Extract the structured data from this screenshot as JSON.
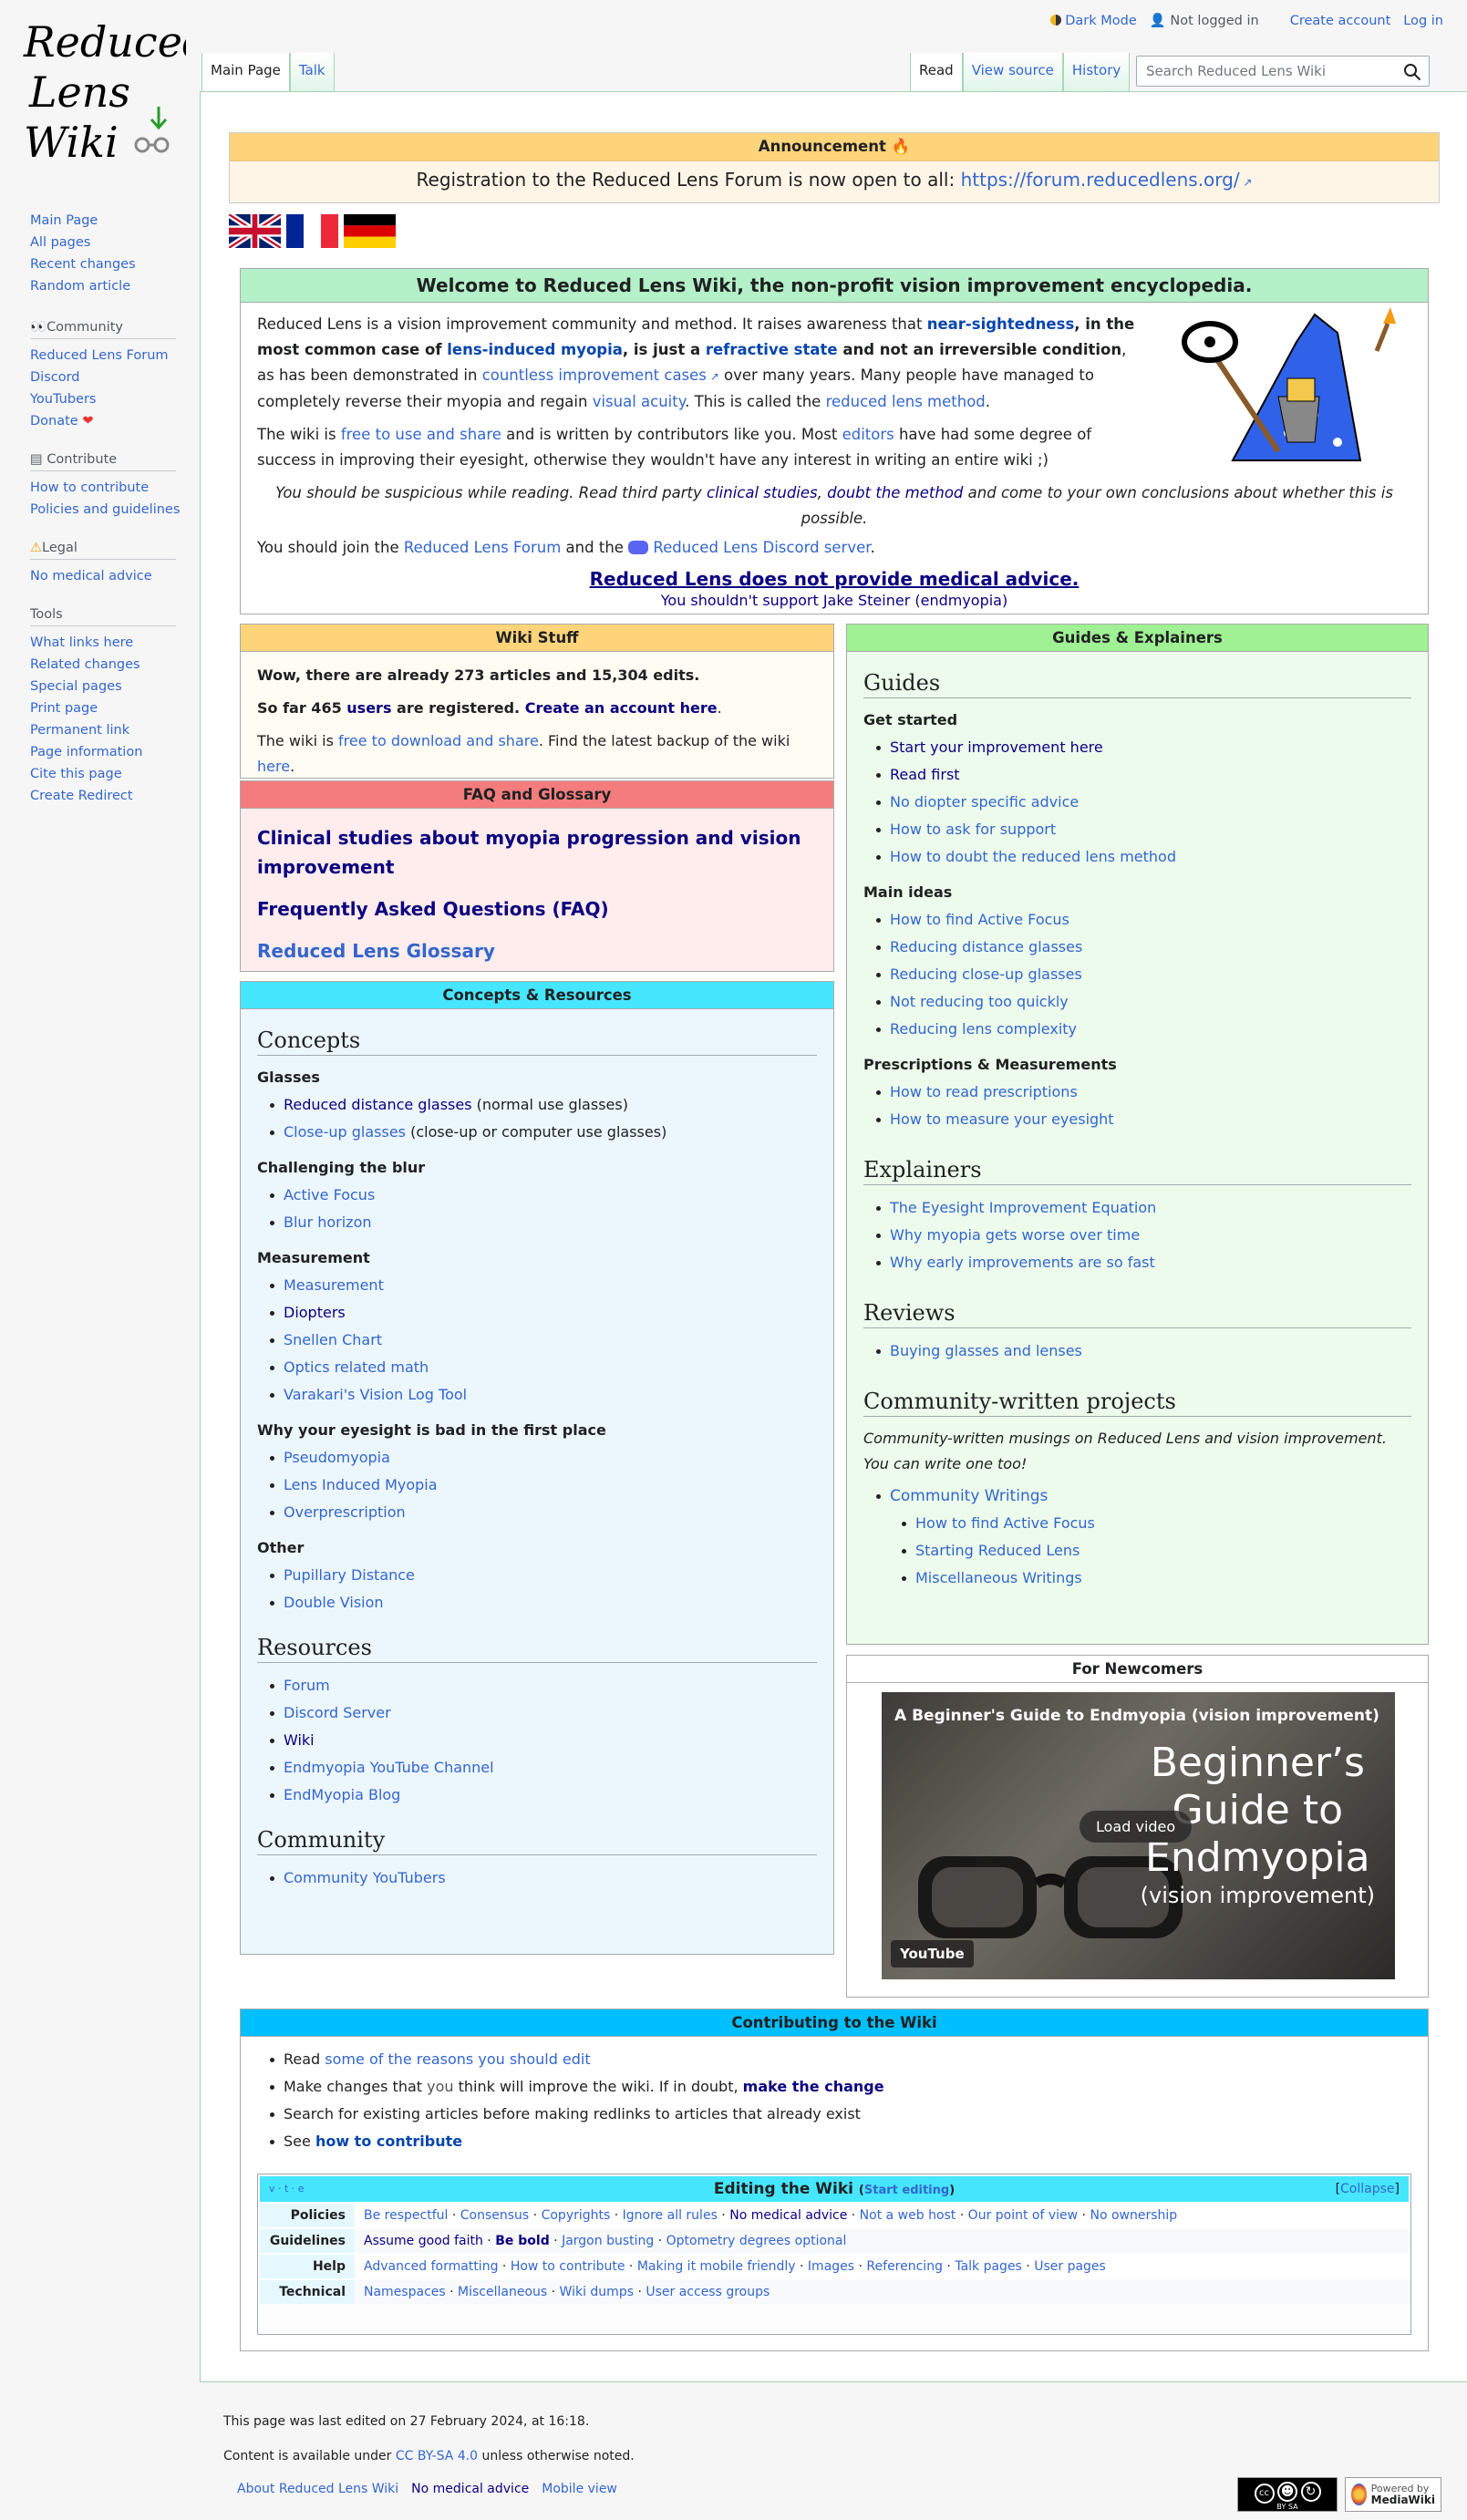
{
  "logo": {
    "line1": "Reduced",
    "line2": "Lens",
    "line3": "Wiki"
  },
  "personal": {
    "dark_mode": "Dark Mode",
    "not_logged_in": "Not logged in",
    "create_account": "Create account",
    "login": "Log in"
  },
  "tabs": {
    "main_page": "Main Page",
    "talk": "Talk",
    "read": "Read",
    "view_source": "View source",
    "history": "History"
  },
  "search": {
    "placeholder": "Search Reduced Lens Wiki"
  },
  "sidebar": {
    "nav": [
      "Main Page",
      "All pages",
      "Recent changes",
      "Random article"
    ],
    "community_heading": "Community",
    "community": [
      "Reduced Lens Forum",
      "Discord",
      "YouTubers",
      "Donate"
    ],
    "contribute_heading": "Contribute",
    "contribute": [
      "How to contribute",
      "Policies and guidelines"
    ],
    "legal_heading": "Legal",
    "legal": [
      "No medical advice"
    ],
    "tools_heading": "Tools",
    "tools": [
      "What links here",
      "Related changes",
      "Special pages",
      "Print page",
      "Permanent link",
      "Page information",
      "Cite this page",
      "Create Redirect"
    ]
  },
  "announcement": {
    "title": "Announcement",
    "text": "Registration to the Reduced Lens Forum is now open to all:",
    "link": "https://forum.reducedlens.org/"
  },
  "welcome": {
    "title": "Welcome to Reduced Lens Wiki, the non-profit vision improvement encyclopedia.",
    "p1a": "Reduced Lens is a vision improvement community and method. It raises awareness that ",
    "p1_near": "near-sightedness",
    "p1b": ", in the most common case of ",
    "p1_lim": "lens-induced myopia",
    "p1c": ", is just a ",
    "p1_rs": "refractive state",
    "p1d": " and not an irreversible condition",
    "p1e": ", as has been demonstrated in ",
    "p1_cic": "countless improvement cases",
    "p1f": " over many years. Many people have managed to completely reverse their myopia and regain ",
    "p1_va": "visual acuity",
    "p1g": ". This is called the ",
    "p1_rlm": "reduced lens method",
    "p1h": ".",
    "p2a": "The wiki is ",
    "p2_free": "free to use and share",
    "p2b": " and is written by contributors like you. Most ",
    "p2_ed": "editors",
    "p2c": " have had some degree of success in improving their eyesight, otherwise they wouldn't have any interest in writing an entire wiki ;)",
    "p3a": "You should be suspicious while reading. Read third party ",
    "p3_cs": "clinical studies",
    "p3b": ", ",
    "p3_dm": "doubt the method",
    "p3c": " and come to your own conclusions about whether this is possible.",
    "p4a": "You should join the ",
    "p4_forum": "Reduced Lens Forum",
    "p4b": " and the ",
    "p4_discord": "Reduced Lens Discord server",
    "p4c": ".",
    "medical": "Reduced Lens does not provide medical advice.",
    "support": "You shouldn't support Jake Steiner (endmyopia)"
  },
  "wiki_stuff": {
    "title": "Wiki Stuff",
    "line1": "Wow, there are already 273 articles and 15,304 edits.",
    "l2a": "So far 465 ",
    "l2_users": "users",
    "l2b": " are registered. ",
    "l2_create": "Create an account here",
    "l3a": "The wiki is ",
    "l3_free": "free to download and share",
    "l3b": ". Find the latest backup of the wiki ",
    "l3_here": "here",
    "l3c": "."
  },
  "faq": {
    "title": "FAQ and Glossary",
    "items": [
      "Clinical studies about myopia progression and vision improvement",
      "Frequently Asked Questions (FAQ)",
      "Reduced Lens Glossary"
    ]
  },
  "concepts": {
    "title": "Concepts & Resources",
    "h_concepts": "Concepts",
    "glasses": "Glasses",
    "g1": "Reduced distance glasses",
    "g1n": " (normal use glasses)",
    "g2": "Close-up glasses",
    "g2n": " (close-up or computer use glasses)",
    "blur": "Challenging the blur",
    "blur_items": [
      "Active Focus",
      "Blur horizon"
    ],
    "measurement": "Measurement",
    "meas_items": [
      "Measurement",
      "Diopters",
      "Snellen Chart",
      "Optics related math",
      "Varakari's Vision Log Tool"
    ],
    "bad": "Why your eyesight is bad in the first place",
    "bad_items": [
      "Pseudomyopia",
      "Lens Induced Myopia",
      "Overprescription"
    ],
    "other": "Other",
    "other_items": [
      "Pupillary Distance",
      "Double Vision"
    ],
    "h_resources": "Resources",
    "res_items": [
      "Forum",
      "Discord Server",
      "Wiki",
      "Endmyopia YouTube Channel",
      "EndMyopia Blog"
    ],
    "h_community": "Community",
    "com_items": [
      "Community YouTubers"
    ]
  },
  "guides": {
    "title": "Guides & Explainers",
    "h_guides": "Guides",
    "get_started": "Get started",
    "gs_items": [
      "Start your improvement here",
      "Read first",
      "No diopter specific advice",
      "How to ask for support",
      "How to doubt the reduced lens method"
    ],
    "main_ideas": "Main ideas",
    "mi_items": [
      "How to find Active Focus",
      "Reducing distance glasses",
      "Reducing close-up glasses",
      "Not reducing too quickly",
      "Reducing lens complexity"
    ],
    "presc": "Prescriptions & Measurements",
    "pr_items": [
      "How to read prescriptions",
      "How to measure your eyesight"
    ],
    "h_explainers": "Explainers",
    "ex_items": [
      "The Eyesight Improvement Equation",
      "Why myopia gets worse over time",
      "Why early improvements are so fast"
    ],
    "h_reviews": "Reviews",
    "rev_items": [
      "Buying glasses and lenses"
    ],
    "h_cwp": "Community-written projects",
    "cwp_text": "Community-written musings on Reduced Lens and vision improvement. You can write one too!",
    "cw": "Community Writings",
    "cw_items": [
      "How to find Active Focus",
      "Starting Reduced Lens",
      "Miscellaneous Writings"
    ]
  },
  "newcomers": {
    "title": "For Newcomers",
    "video_title": "A Beginner's Guide to Endmyopia (vision improvement)",
    "big1": "Beginner’s",
    "big2": "Guide to",
    "big3": "Endmyopia",
    "big4": "(vision improvement)",
    "load": "Load video",
    "yt": "YouTube"
  },
  "contrib": {
    "title": "Contributing to the Wiki",
    "i1a": "Read ",
    "i1_link": "some of the reasons you should edit",
    "i2a": "Make changes that ",
    "i2_you": "you",
    "i2b": " think will improve the wiki. If in doubt, ",
    "i2_make": "make the change",
    "i3": "Search for existing articles before making redlinks to articles that already exist",
    "i4a": "See ",
    "i4_link": "how to contribute"
  },
  "navbox": {
    "vte": "v · t · e",
    "title": "Editing the Wiki",
    "start": "Start editing",
    "collapse": "Collapse",
    "rows": [
      {
        "group": "Policies",
        "items": [
          "Be respectful",
          "Consensus",
          "Copyrights",
          "Ignore all rules",
          "No medical advice",
          "Not a web host",
          "Our point of view",
          "No ownership"
        ]
      },
      {
        "group": "Guidelines",
        "items": [
          "Assume good faith",
          "Be bold",
          "Jargon busting",
          "Optometry degrees optional"
        ]
      },
      {
        "group": "Help",
        "items": [
          "Advanced formatting",
          "How to contribute",
          "Making it mobile friendly",
          "Images",
          "Referencing",
          "Talk pages",
          "User pages"
        ]
      },
      {
        "group": "Technical",
        "items": [
          "Namespaces",
          "Miscellaneous",
          "Wiki dumps",
          "User access groups"
        ]
      }
    ]
  },
  "footer": {
    "edited": "This page was last edited on 27 February 2024, at 16:18.",
    "ca": "Content is available under ",
    "cc": "CC BY-SA 4.0",
    "cb": " unless otherwise noted.",
    "links": [
      "About Reduced Lens Wiki",
      "No medical advice",
      "Mobile view"
    ],
    "cc_badge": "BY SA",
    "mw1": "Powered by",
    "mw2": "MediaWiki"
  },
  "colors": {
    "content_border": "#a3d3ac",
    "announcement": "#fed47b",
    "welcome": "#b4f0c8",
    "faq": "#f47c7c",
    "concepts": "#46e6ff",
    "guides": "#9ff193",
    "contrib": "#00bfff"
  }
}
